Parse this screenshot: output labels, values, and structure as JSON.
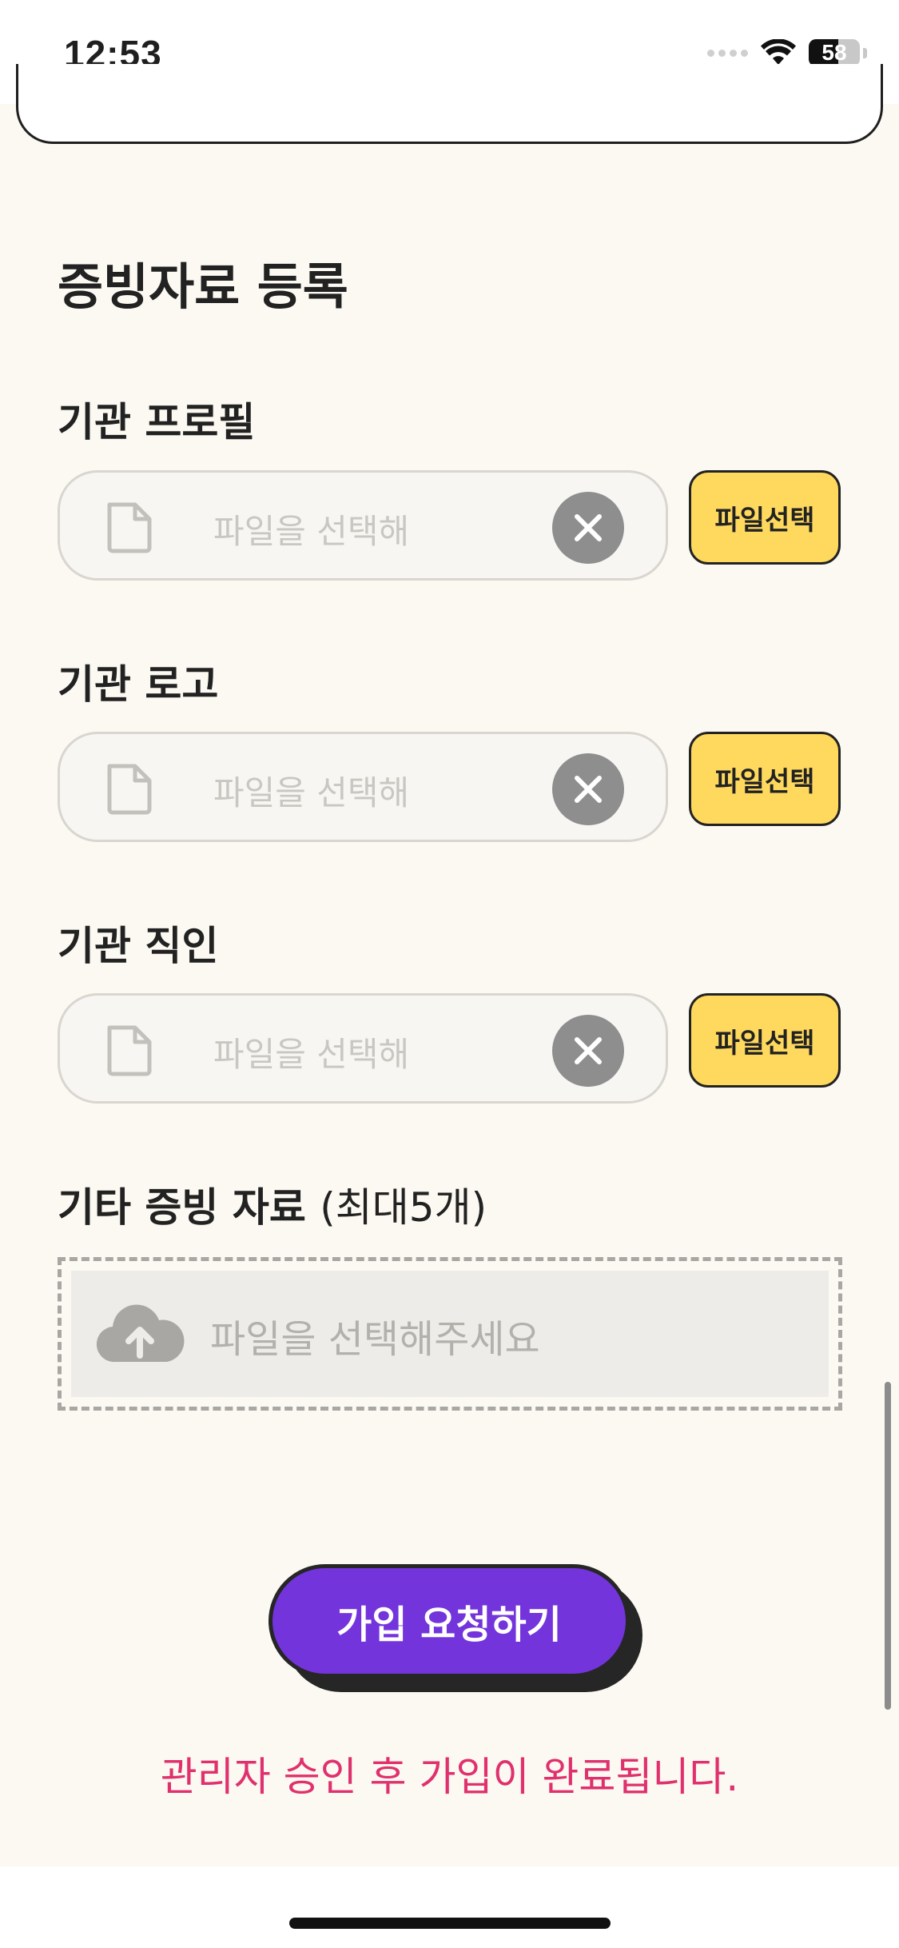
{
  "status_bar": {
    "time": "12:53",
    "battery": "58",
    "battery_level": 0.58
  },
  "section": {
    "title": "증빙자료 등록"
  },
  "fields": [
    {
      "label": "기관 프로필",
      "placeholder": "파일을 선택해",
      "file_icon": "document-icon",
      "clear_icon": "close-icon",
      "choose_label": "파일선택"
    },
    {
      "label": "기관 로고",
      "placeholder": "파일을 선택해",
      "file_icon": "document-icon",
      "clear_icon": "close-icon",
      "choose_label": "파일선택"
    },
    {
      "label": "기관 직인",
      "placeholder": "파일을 선택해",
      "file_icon": "document-icon",
      "clear_icon": "close-icon",
      "choose_label": "파일선택"
    }
  ],
  "extra_docs": {
    "label": "기타 증빙 자료",
    "label_note": "(최대5개)",
    "placeholder": "파일을 선택해주세요",
    "icon": "cloud-upload-icon"
  },
  "submit": {
    "label": "가입 요청하기"
  },
  "notice": "관리자 승인 후 가입이 완료됩니다.",
  "colors": {
    "background": "#fbf9f1",
    "accent_yellow": "#ffd95e",
    "submit_purple": "#7434dc",
    "notice_pink": "#e0306e"
  }
}
